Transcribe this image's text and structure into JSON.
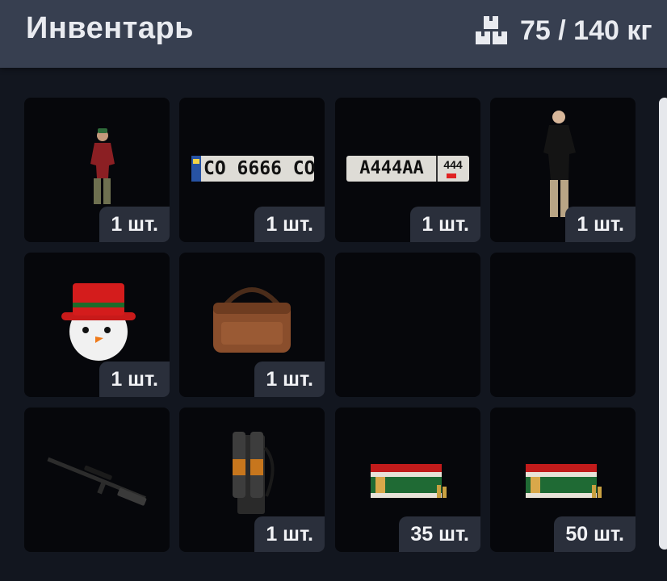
{
  "header": {
    "title": "Инвентарь",
    "weight_text": "75 / 140 кг",
    "weight_icon": "boxes-icon"
  },
  "inventory": {
    "slots": [
      {
        "item": "skin-man-red-sweater-icon",
        "quantity": "1 шт."
      },
      {
        "item": "license-plate-co6666co-icon",
        "plate_text": "CO 6666 CO",
        "quantity": "1 шт."
      },
      {
        "item": "license-plate-a444aa-icon",
        "plate_text": "A444AA",
        "region": "444",
        "quantity": "1 шт."
      },
      {
        "item": "skin-man-black-sweater-icon",
        "quantity": "1 шт."
      },
      {
        "item": "snowman-head-icon",
        "quantity": "1 шт."
      },
      {
        "item": "leather-bag-icon",
        "quantity": "1 шт."
      },
      {
        "item": "empty",
        "quantity": ""
      },
      {
        "item": "empty",
        "quantity": ""
      },
      {
        "item": "sniper-rifle-icon",
        "quantity": ""
      },
      {
        "item": "backpack-canisters-icon",
        "quantity": "1 шт."
      },
      {
        "item": "ammo-box-icon",
        "quantity": "35 шт."
      },
      {
        "item": "ammo-box-icon",
        "quantity": "50 шт."
      }
    ]
  },
  "colors": {
    "header_bg": "#373f50",
    "page_bg": "#12161f",
    "slot_bg": "#06070b",
    "badge_bg": "#2a2f3b",
    "text": "#e9ebf0"
  }
}
